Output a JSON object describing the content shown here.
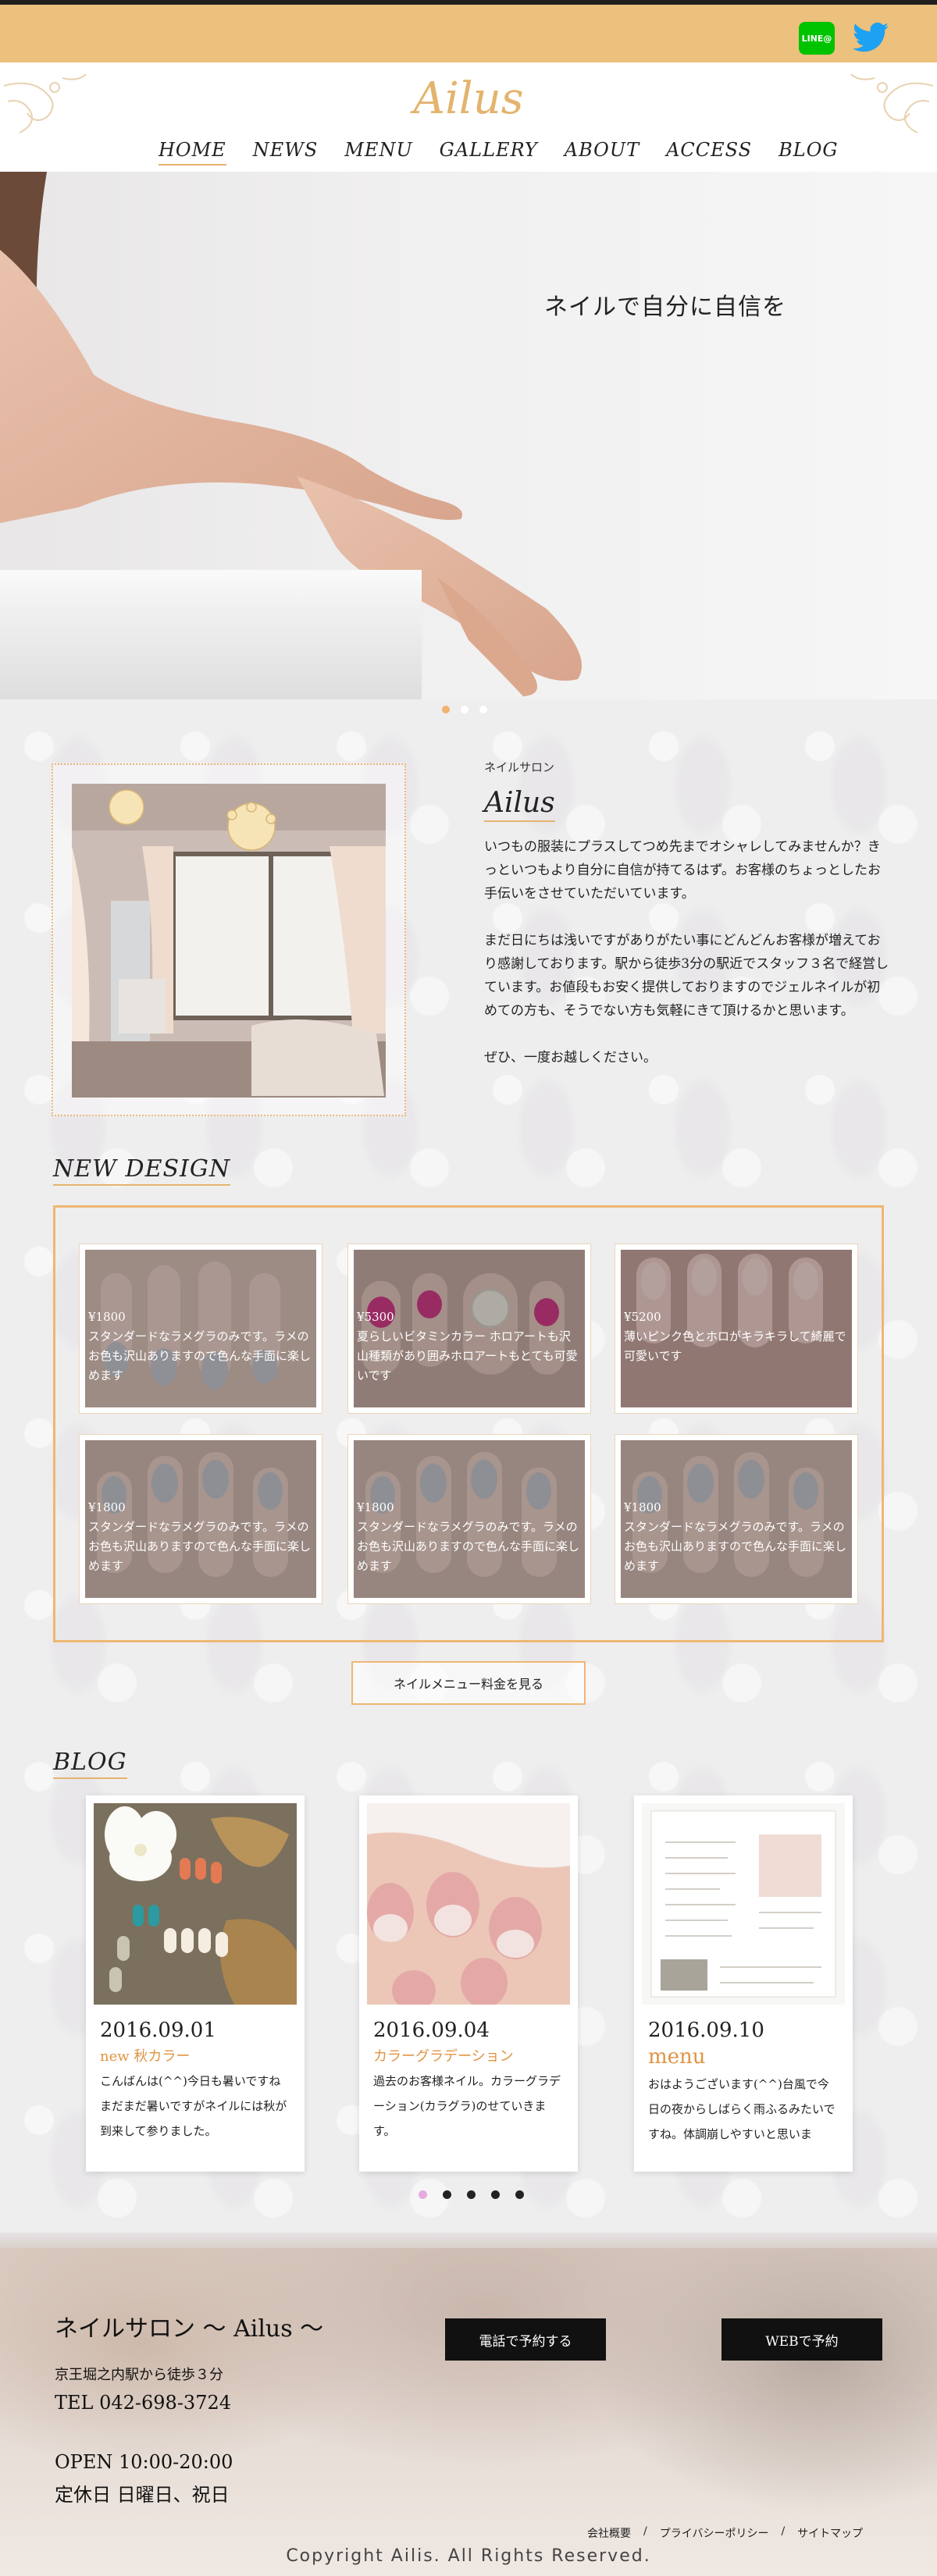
{
  "topbar": {
    "line_label": "LINE@",
    "twitter_icon": "twitter-icon"
  },
  "header": {
    "logo": "Ailus",
    "nav": [
      "HOME",
      "NEWS",
      "MENU",
      "GALLERY",
      "ABOUT",
      "ACCESS",
      "BLOG"
    ],
    "active_nav": "HOME"
  },
  "hero": {
    "tagline": "ネイルで自分に自信を",
    "slide_count": 3,
    "active_slide": 1
  },
  "about": {
    "small_label": "ネイルサロン",
    "title": "Ailus",
    "paragraphs": [
      "いつもの服装にプラスしてつめ先までオシャレしてみませんか？きっといつもより自分に自信が持てるはず。お客様のちょっとしたお手伝いをさせていただいています。",
      "まだ日にちは浅いですがありがたい事にどんどんお客様が増えており感謝しております。駅から徒歩3分の駅近でスタッフ３名で経営しています。お値段もお安く提供しておりますのでジェルネイルが初めての方も、そうでない方も気軽にきて頂けるかと思います。",
      "ぜひ、一度お越しください。"
    ]
  },
  "new_design": {
    "heading": "NEW DESIGN",
    "items": [
      {
        "price": "¥1800",
        "text": "スタンダードなラメグラのみです。ラメのお色も沢山ありますので色んな手面に楽しめます"
      },
      {
        "price": "¥5300",
        "text": "夏らしいビタミンカラー ホロアートも沢山種類があり囲みホロアートもとても可愛いです"
      },
      {
        "price": "¥5200",
        "text": "薄いピンク色とホロがキラキラして綺麗で可愛いです"
      },
      {
        "price": "¥1800",
        "text": "スタンダードなラメグラのみです。ラメのお色も沢山ありますので色んな手面に楽しめます"
      },
      {
        "price": "¥1800",
        "text": "スタンダードなラメグラのみです。ラメのお色も沢山ありますので色んな手面に楽しめます"
      },
      {
        "price": "¥1800",
        "text": "スタンダードなラメグラのみです。ラメのお色も沢山ありますので色んな手面に楽しめます"
      }
    ],
    "menu_button": "ネイルメニュー料金を見る"
  },
  "blog": {
    "heading": "BLOG",
    "posts": [
      {
        "date": "2016.09.01",
        "title": "new 秋カラー",
        "body": "こんばんは(^^)今日も暑いですねまだまだ暑いですがネイルには秋が到来して参りました。"
      },
      {
        "date": "2016.09.04",
        "title": "カラーグラデーション",
        "body": "過去のお客様ネイル。カラーグラデーション(カラグラ)のせていきます。"
      },
      {
        "date": "2016.09.10",
        "title": "menu",
        "body": "おはようございます(^^)台風で今日の夜からしばらく雨ふるみたいですね。体調崩しやすいと思いま"
      }
    ],
    "pager_count": 5,
    "active_page": 1
  },
  "footer": {
    "name": "ネイルサロン 〜 Ailus 〜",
    "access": "京王堀之内駅から徒歩３分",
    "tel": "TEL 042-698-3724",
    "open": "OPEN 10:00-20:00",
    "closed": "定休日 日曜日、祝日",
    "phone_button": "電話で予約する",
    "web_button": "WEBで予約",
    "links": [
      "会社概要",
      "/",
      "プライバシーポリシー",
      "/",
      "サイトマップ"
    ],
    "copyright": "Copyright Ailis. All Rights Reserved."
  },
  "colors": {
    "gold": "#e3b46d",
    "topbar": "#ecc07d",
    "frame": "#eeb773",
    "blog_title": "#e09443"
  }
}
